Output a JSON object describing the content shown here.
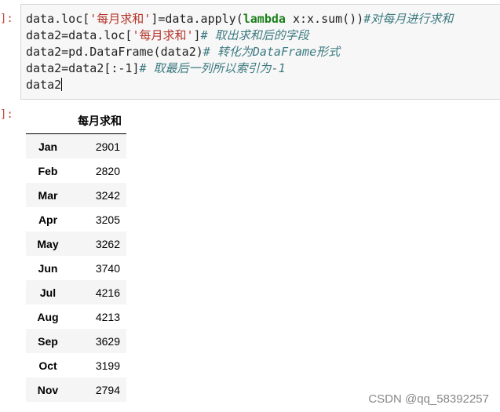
{
  "cell": {
    "in_prompt": "]:",
    "out_prompt": "]:",
    "lines": [
      [
        {
          "t": "data.loc[",
          "c": "plain"
        },
        {
          "t": "'每月求和'",
          "c": "str"
        },
        {
          "t": "]=data.apply(",
          "c": "plain"
        },
        {
          "t": "lambda",
          "c": "kw"
        },
        {
          "t": " x:x.sum())",
          "c": "plain"
        },
        {
          "t": "#对每月进行求和",
          "c": "cm"
        }
      ],
      [
        {
          "t": "data2=data.loc[",
          "c": "plain"
        },
        {
          "t": "'每月求和'",
          "c": "str"
        },
        {
          "t": "]",
          "c": "plain"
        },
        {
          "t": "# 取出求和后的字段",
          "c": "cm"
        }
      ],
      [
        {
          "t": "data2=pd.DataFrame(data2)",
          "c": "plain"
        },
        {
          "t": "# 转化为DataFrame形式",
          "c": "cm"
        }
      ],
      [
        {
          "t": "data2=data2[:-1]",
          "c": "plain"
        },
        {
          "t": "# 取最后一列所以索引为-1",
          "c": "cm"
        }
      ],
      [
        {
          "t": "data2",
          "c": "plain"
        }
      ]
    ]
  },
  "output": {
    "column_header": "每月求和",
    "rows": [
      {
        "month": "Jan",
        "value": "2901"
      },
      {
        "month": "Feb",
        "value": "2820"
      },
      {
        "month": "Mar",
        "value": "3242"
      },
      {
        "month": "Apr",
        "value": "3205"
      },
      {
        "month": "May",
        "value": "3262"
      },
      {
        "month": "Jun",
        "value": "3740"
      },
      {
        "month": "Jul",
        "value": "4216"
      },
      {
        "month": "Aug",
        "value": "4213"
      },
      {
        "month": "Sep",
        "value": "3629"
      },
      {
        "month": "Oct",
        "value": "3199"
      },
      {
        "month": "Nov",
        "value": "2794"
      }
    ]
  },
  "watermark": "CSDN @qq_58392257",
  "colors": {
    "prompt": "#c24a3a",
    "string": "#b5332a",
    "keyword": "#1a7f1a",
    "comment": "#3c7a80",
    "cell_background": "#f7f7f7"
  }
}
